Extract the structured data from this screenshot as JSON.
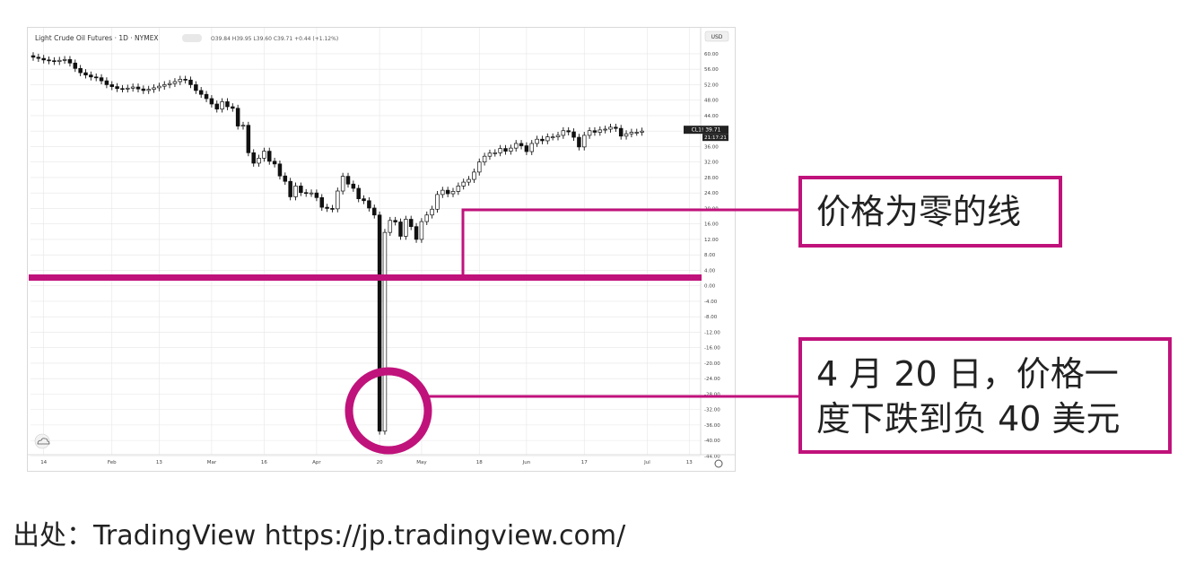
{
  "chart_data": {
    "type": "candlestick",
    "title": "Light Crude Oil Futures · 1D · NYMEX",
    "ohlc_legend": "O39.84 H39.95 L39.60 C39.71 +0.44 (+1.12%)",
    "currency": "USD",
    "price_label": "CL1! 39.71",
    "time_label": "21:17:21",
    "ylim": [
      -46,
      63
    ],
    "y_ticks": [
      "60.00",
      "56.00",
      "52.00",
      "48.00",
      "44.00",
      "40.00",
      "36.00",
      "32.00",
      "28.00",
      "24.00",
      "20.00",
      "16.00",
      "12.00",
      "8.00",
      "4.00",
      "0.00",
      "-4.00",
      "-8.00",
      "-12.00",
      "-16.00",
      "-20.00",
      "-24.00",
      "-28.00",
      "-32.00",
      "-36.00",
      "-40.00",
      "-44.00"
    ],
    "x_ticks": [
      {
        "label": "14",
        "i": 2
      },
      {
        "label": "Feb",
        "i": 15
      },
      {
        "label": "13",
        "i": 24
      },
      {
        "label": "Mar",
        "i": 34
      },
      {
        "label": "16",
        "i": 44
      },
      {
        "label": "Apr",
        "i": 54
      },
      {
        "label": "20",
        "i": 66
      },
      {
        "label": "May",
        "i": 74
      },
      {
        "label": "18",
        "i": 85
      },
      {
        "label": "Jun",
        "i": 94
      },
      {
        "label": "17",
        "i": 105
      },
      {
        "label": "Jul",
        "i": 117
      },
      {
        "label": "13",
        "i": 125
      }
    ],
    "close_series": [
      59.1,
      58.8,
      58.4,
      58.2,
      58.0,
      58.3,
      58.5,
      57.6,
      56.2,
      55.1,
      54.5,
      54.0,
      53.8,
      53.0,
      52.0,
      51.5,
      51.0,
      50.9,
      51.1,
      51.4,
      50.9,
      50.5,
      50.8,
      51.2,
      51.6,
      52.0,
      52.3,
      52.8,
      53.4,
      53.2,
      52.0,
      50.5,
      49.5,
      48.4,
      47.0,
      45.7,
      47.6,
      46.3,
      45.9,
      41.3,
      41.5,
      34.4,
      31.7,
      33.0,
      34.8,
      32.2,
      31.5,
      28.4,
      27.0,
      23.0,
      25.8,
      24.1,
      23.9,
      24.0,
      22.8,
      20.3,
      20.0,
      19.9,
      24.5,
      28.3,
      26.3,
      25.2,
      22.5,
      22.0,
      20.1,
      18.3,
      -37.6,
      13.8,
      16.9,
      16.5,
      12.8,
      17.2,
      15.3,
      12.0,
      16.6,
      18.3,
      19.8,
      23.6,
      24.7,
      23.8,
      24.4,
      25.8,
      26.8,
      27.5,
      29.4,
      32.0,
      33.5,
      34.3,
      34.4,
      35.5,
      34.8,
      35.6,
      36.8,
      36.2,
      34.7,
      36.8,
      37.9,
      37.5,
      38.5,
      38.5,
      38.9,
      40.1,
      39.8,
      38.4,
      35.9,
      38.9,
      40.1,
      39.7,
      40.3,
      40.5,
      41.0,
      40.7,
      38.7,
      39.3,
      39.7,
      39.7,
      40.0
    ],
    "zero_line_value": 0
  },
  "annotations": {
    "zero_line_label": "价格为零的线",
    "negative_line1": "4 月 20 日，价格一",
    "negative_line2": "度下跌到负 40 美元"
  },
  "source": "出处：TradingView https://jp.tradingview.com/",
  "colors": {
    "accent": "#c0127b",
    "candle_down": "#111111",
    "candle_up": "#ffffff",
    "grid": "#e6e6e6"
  }
}
